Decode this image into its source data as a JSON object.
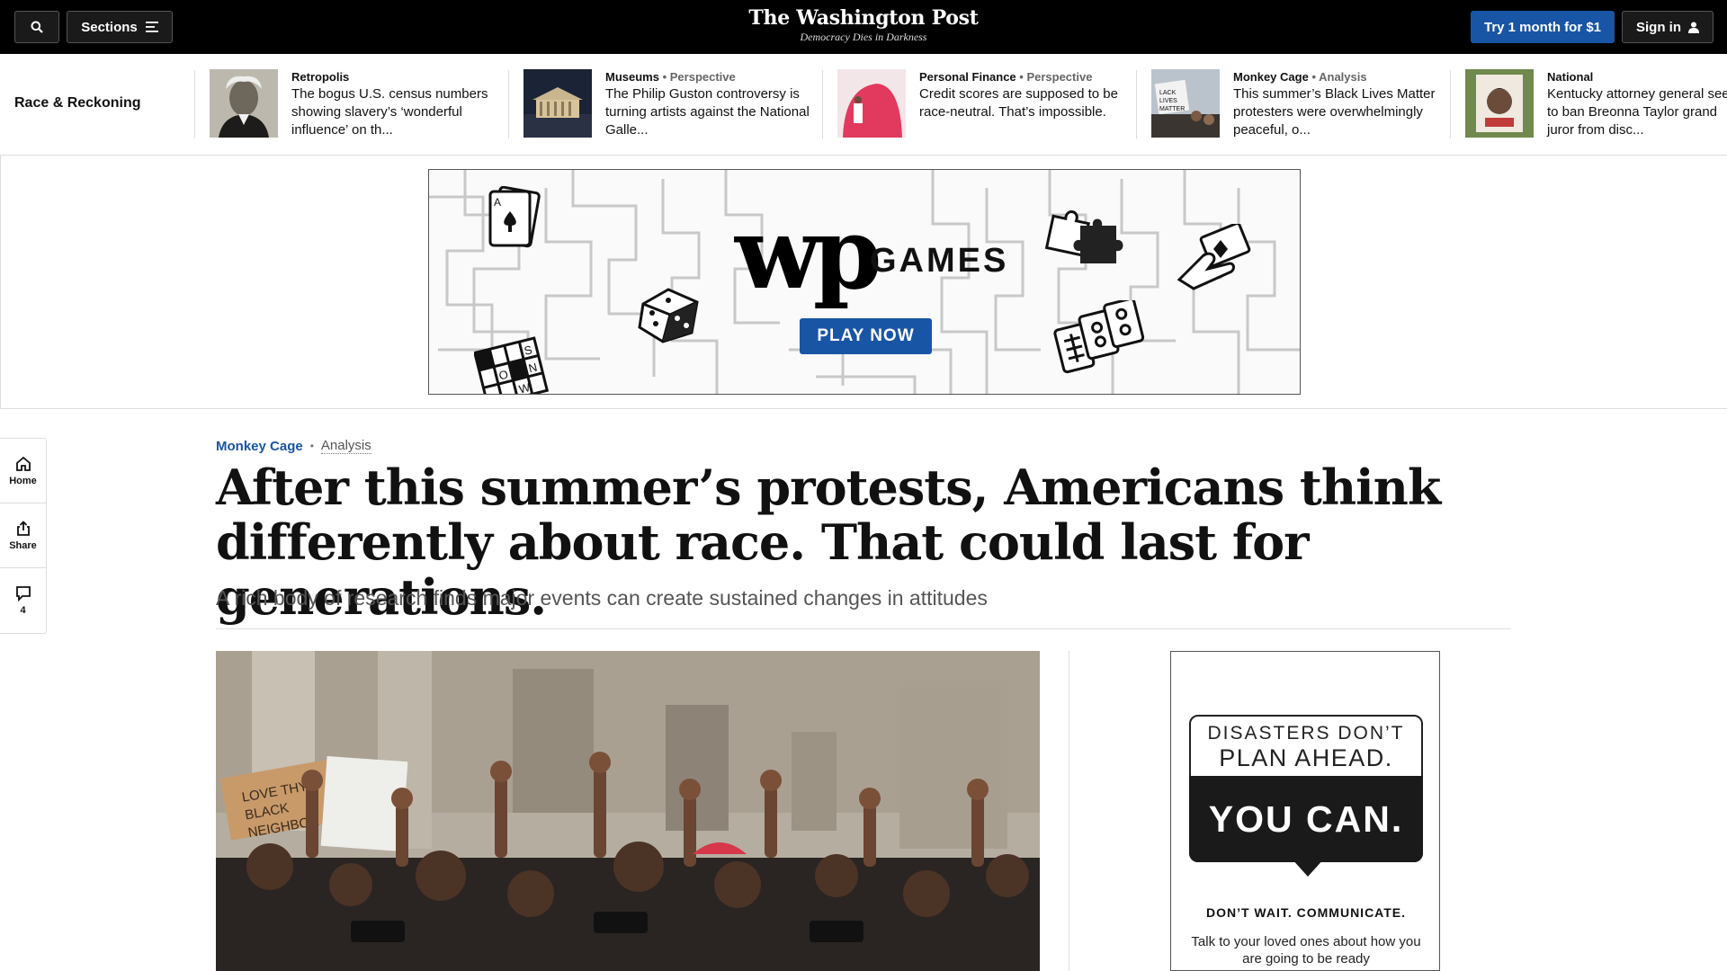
{
  "topbar": {
    "sections_label": "Sections",
    "brand_name": "The Washington Post",
    "brand_tagline": "Democracy Dies in Darkness",
    "try_label": "Try 1 month for $1",
    "signin_label": "Sign in",
    "icons": [
      "search-icon",
      "menu-icon",
      "user-icon"
    ]
  },
  "strip": {
    "title": "Race & Reckoning",
    "stories": [
      {
        "section": "Retropolis",
        "label": "",
        "headline": "The bogus U.S. census numbers showing slavery’s ‘wonderful influence’ on th..."
      },
      {
        "section": "Museums",
        "label": "• Perspective",
        "headline": "The Philip Guston controversy is turning artists against the National Galle..."
      },
      {
        "section": "Personal Finance",
        "label": "• Perspective",
        "headline": "Credit scores are supposed to be race-neutral. That’s impossible."
      },
      {
        "section": "Monkey Cage",
        "label": "• Analysis",
        "headline": "This summer’s Black Lives Matter protesters were overwhelmingly peaceful, o..."
      },
      {
        "section": "National",
        "label": "",
        "headline": "Kentucky attorney general seeks to ban Breonna Taylor grand juror from disc..."
      }
    ]
  },
  "ad_games": {
    "logo_text": "wp",
    "games_label": "GAMES",
    "play_label": "PLAY NOW",
    "tile_letters": [
      "S",
      "N",
      "O",
      "W"
    ]
  },
  "rail": {
    "home_label": "Home",
    "share_label": "Share",
    "comments_count": "4"
  },
  "article": {
    "section": "Monkey Cage",
    "dot": "•",
    "label": "Analysis",
    "headline": "After this summer’s protests, Americans think differently about race. That could last for generations.",
    "dek": "A rich body of research finds major events can create sustained changes in attitudes"
  },
  "hero": {
    "sign_text": "LOVE THY BLACK NEIGHBOR"
  },
  "ad_right": {
    "line1": "DISASTERS DON’T",
    "line2": "PLAN AHEAD.",
    "line_big": "YOU CAN.",
    "line3": "DON’T WAIT. COMMUNICATE.",
    "line4": "Talk to your loved ones about how you are going to be ready"
  }
}
